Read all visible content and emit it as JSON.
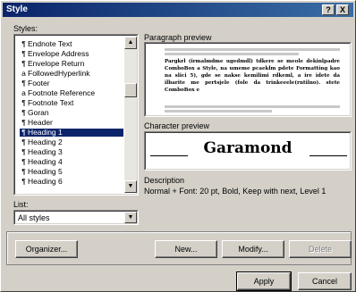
{
  "window": {
    "title": "Style",
    "help_glyph": "?",
    "close_glyph": "X"
  },
  "styles_label": "Styles:",
  "styles": [
    {
      "mark": "¶",
      "name": "Endnote Text"
    },
    {
      "mark": "¶",
      "name": "Envelope Address"
    },
    {
      "mark": "¶",
      "name": "Envelope Return"
    },
    {
      "mark": "a",
      "name": "FollowedHyperlink"
    },
    {
      "mark": "¶",
      "name": "Footer"
    },
    {
      "mark": "a",
      "name": "Footnote Reference"
    },
    {
      "mark": "¶",
      "name": "Footnote Text"
    },
    {
      "mark": "¶",
      "name": "Goran"
    },
    {
      "mark": "¶",
      "name": "Header"
    },
    {
      "mark": "¶",
      "name": "Heading 1",
      "selected": true
    },
    {
      "mark": "¶",
      "name": "Heading 2"
    },
    {
      "mark": "¶",
      "name": "Heading 3"
    },
    {
      "mark": "¶",
      "name": "Heading 4"
    },
    {
      "mark": "¶",
      "name": "Heading 5"
    },
    {
      "mark": "¶",
      "name": "Heading 6"
    }
  ],
  "list_label": "List:",
  "list_value": "All styles",
  "paragraph_preview_label": "Paragraph preview",
  "paragraph_preview_text": "Pargkrl (irmalmdme ugedmdl) tdkere se meole dekinlpadre ComboBox a Style, na umeme pcaeklm pdete Formatting kao na slici 5), gde se nakse kemilimi rdkeml, a ire idete da ilbarite me pertsjele (fole da trinkeeele(rntilno). stete ComboBox e",
  "character_preview_label": "Character preview",
  "character_preview_text": "Garamond",
  "description_label": "Description",
  "description_text": "Normal + Font: 20 pt, Bold, Keep with next, Level 1",
  "buttons": {
    "organizer": "Organizer...",
    "new": "New...",
    "modify": "Modify...",
    "delete": "Delete",
    "apply": "Apply",
    "cancel": "Cancel"
  },
  "colors": {
    "titlebar": "#0a246a",
    "selection": "#0a246a",
    "face": "#d4d0c8"
  }
}
